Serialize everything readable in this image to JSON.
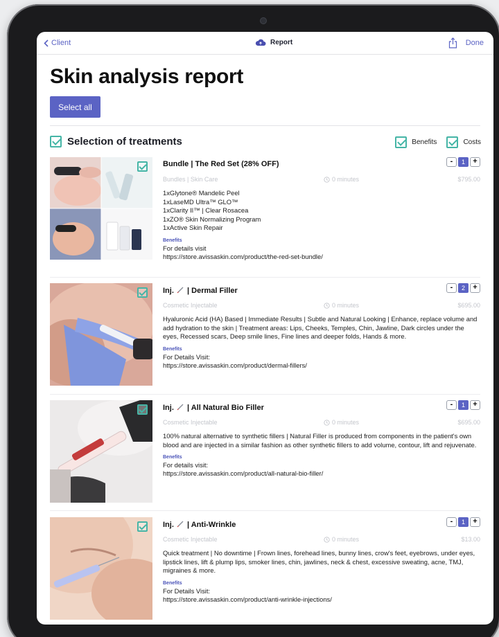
{
  "nav": {
    "back_label": "Client",
    "title": "Report",
    "done_label": "Done"
  },
  "page": {
    "title": "Skin analysis report",
    "select_all_label": "Select all",
    "section_title": "Selection of treatments",
    "opt_benefits": "Benefits",
    "opt_costs": "Costs"
  },
  "treatments": [
    {
      "name": "Bundle | The Red Set (28% OFF)",
      "category": "Bundles | Skin Care",
      "duration": "0 minutes",
      "price": "$795.00",
      "quantity": "1",
      "description": "1xGlytone® Mandelic Peel\n1xLaseMD Ultra™ GLO™\n1xClarity II™ | Clear Rosacea\n1xZO® Skin Normalizing Program\n1xActive Skin Repair",
      "benefits_label": "Benefits",
      "benefits_text": "For details visit\nhttps://store.avissaskin.com/product/the-red-set-bundle/"
    },
    {
      "name_prefix": "Inj.",
      "name_suffix": "| Dermal Filler",
      "category": "Cosmetic Injectable",
      "duration": "0 minutes",
      "price": "$695.00",
      "quantity": "2",
      "description": "Hyaluronic Acid (HA) Based | Immediate Results | Subtle and Natural Looking | Enhance, replace volume and add hydration to the skin | Treatment areas: Lips, Cheeks, Temples, Chin, Jawline, Dark circles under the eyes, Recessed scars, Deep smile lines, Fine lines and deeper folds, Hands & more.",
      "benefits_label": "Benefits",
      "benefits_text": "For Details Visit:\nhttps://store.avissaskin.com/product/dermal-fillers/"
    },
    {
      "name_prefix": "Inj.",
      "name_suffix": "| All Natural Bio Filler",
      "category": "Cosmetic Injectable",
      "duration": "0 minutes",
      "price": "$695.00",
      "quantity": "1",
      "description": "100% natural alternative to synthetic fillers | Natural Filler is produced from components in the patient's own blood and are injected in a similar fashion as other synthetic fillers to add volume, contour, lift and rejuvenate.",
      "benefits_label": "Benefits",
      "benefits_text": "For details visit:\nhttps://store.avissaskin.com/product/all-natural-bio-filler/"
    },
    {
      "name_prefix": "Inj.",
      "name_suffix": "| Anti-Wrinkle",
      "category": "Cosmetic Injectable",
      "duration": "0 minutes",
      "price": "$13.00",
      "quantity": "1",
      "description": "Quick treatment | No downtime | Frown lines, forehead lines, bunny lines, crow's feet, eyebrows, under eyes, lipstick lines, lift & plump lips, smoker lines, chin, jawlines, neck & chest, excessive sweating, acne, TMJ, migraines & more.",
      "benefits_label": "Benefits",
      "benefits_text": "For Details Visit:\nhttps://store.avissaskin.com/product/anti-wrinkle-injections/"
    }
  ],
  "icons": {
    "back": "chevron-left-icon",
    "cloud": "cloud-icon",
    "share": "share-icon",
    "check": "checkbox-checked-icon",
    "syringe": "syringe-icon",
    "clock": "clock-icon"
  },
  "colors": {
    "accent": "#5b63c4",
    "check": "#45b5a6",
    "muted": "#c4c6cc"
  }
}
